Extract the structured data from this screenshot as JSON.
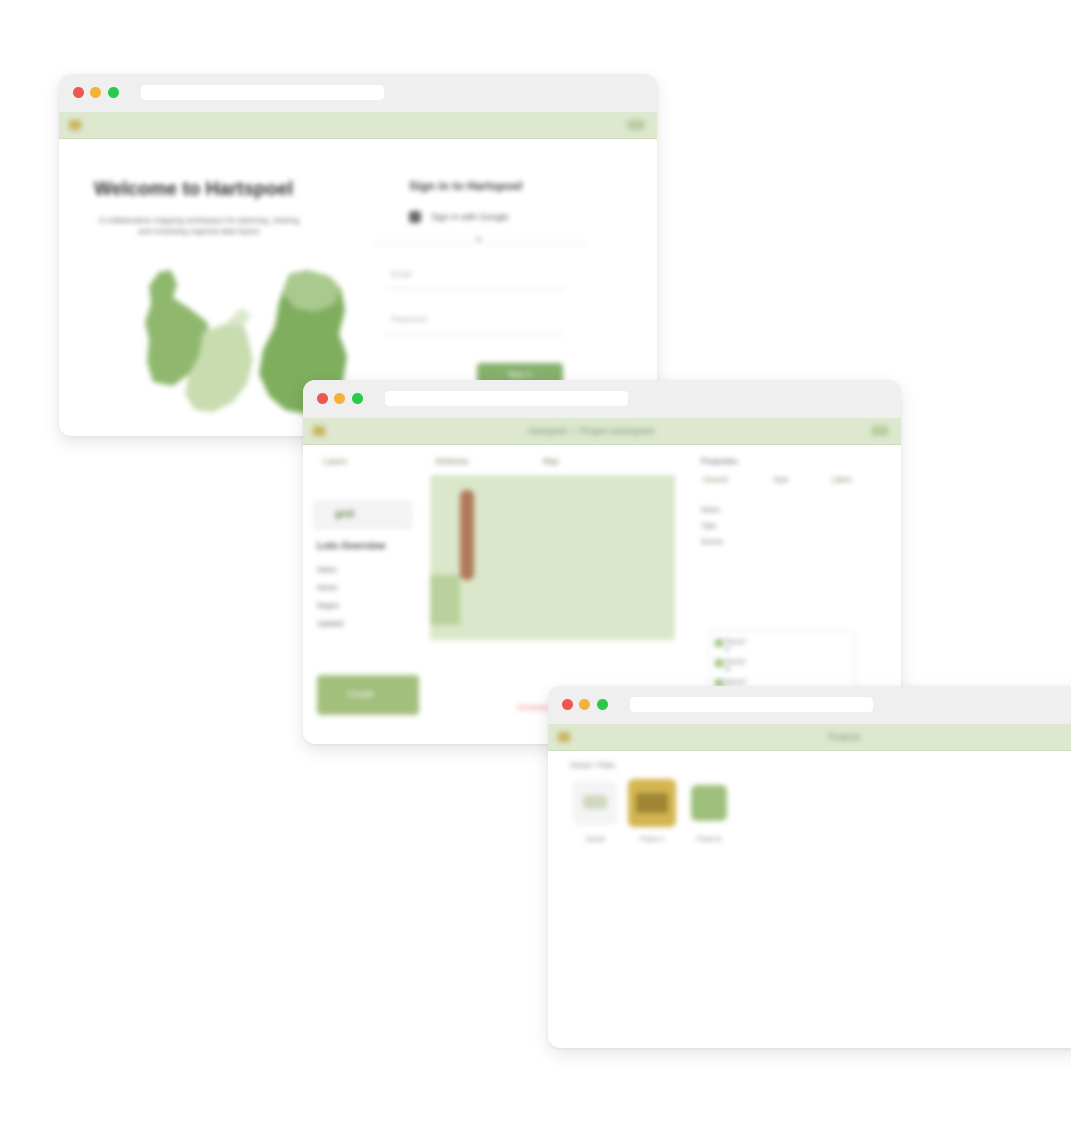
{
  "colors": {
    "window_chrome": "#efefef",
    "app_bar": "#dde8cf",
    "accent_green": "#86b06b",
    "light_green": "#dae7ca",
    "mid_green": "#8fb86e",
    "pale_green": "#c8dcb0",
    "gold": "#d4b550",
    "traffic_red": "#ee5650",
    "traffic_yellow": "#f3b23a",
    "traffic_green": "#2cc84a"
  },
  "login_window": {
    "hero": {
      "title": "Welcome to Hartspoel",
      "subtitle": "A collaborative mapping workspace for planning, sharing and reviewing regional data layers"
    },
    "signin": {
      "title": "Sign in to Hartspoel",
      "sso_label": "Sign in with Google",
      "or_label": "or",
      "email_placeholder": "Email",
      "password_placeholder": "Password",
      "submit_label": "Sign in"
    }
  },
  "editor_window": {
    "app_title": "Hartspoel — Project workspace",
    "tabs": [
      "Layers",
      "Attributes",
      "Map"
    ],
    "brand": "grid",
    "project_title": "Lots Overview",
    "side_rows": [
      "Status",
      "Owner",
      "Region",
      "Updated"
    ],
    "primary_label": "Create",
    "details_title": "Properties",
    "detail_tabs": [
      "General",
      "Style",
      "Labels"
    ],
    "detail_rows": [
      "Name",
      "Type",
      "Source"
    ],
    "list_items": [
      "Parcel A",
      "Parcel B",
      "Parcel C"
    ],
    "warning": "Unsaved"
  },
  "gallery_window": {
    "app_title": "Projects",
    "breadcrumb": "Home / Files",
    "tiles": [
      {
        "label": "Upload",
        "color": "#f4f4f4"
      },
      {
        "label": "Project A",
        "color": "#d4b550"
      },
      {
        "label": "Project B",
        "color": "#9fbf7c"
      }
    ]
  }
}
